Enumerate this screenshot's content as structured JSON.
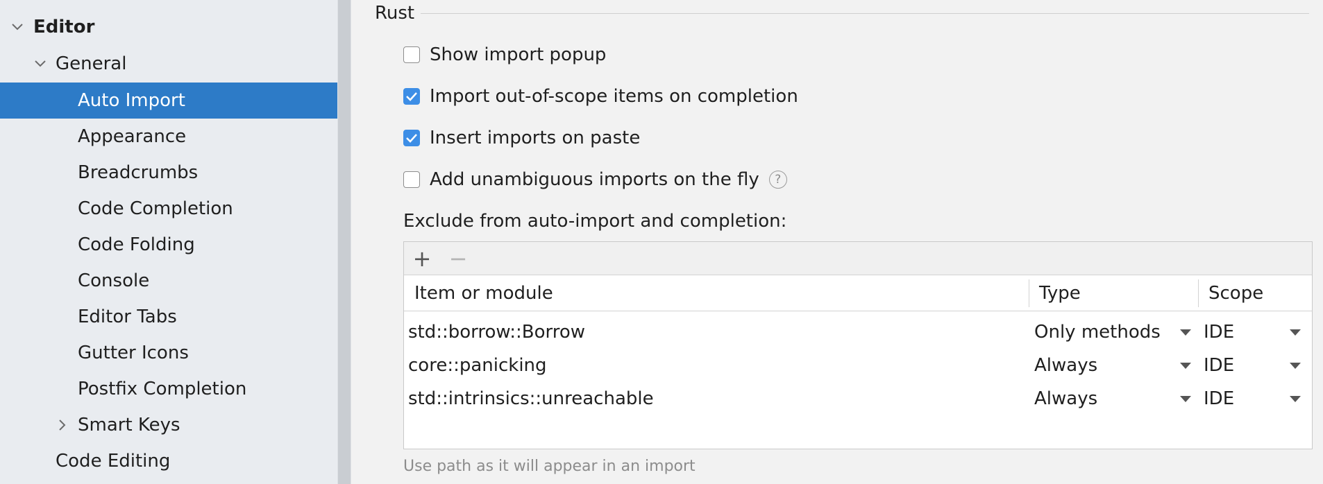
{
  "sidebar": {
    "editor_label": "Editor",
    "general_label": "General",
    "items": [
      {
        "label": "Auto Import"
      },
      {
        "label": "Appearance"
      },
      {
        "label": "Breadcrumbs"
      },
      {
        "label": "Code Completion"
      },
      {
        "label": "Code Folding"
      },
      {
        "label": "Console"
      },
      {
        "label": "Editor Tabs"
      },
      {
        "label": "Gutter Icons"
      },
      {
        "label": "Postfix Completion"
      },
      {
        "label": "Smart Keys"
      }
    ],
    "code_editing_label": "Code Editing",
    "selected": "Auto Import"
  },
  "section": {
    "title": "Rust"
  },
  "options": [
    {
      "label": "Show import popup",
      "checked": false
    },
    {
      "label": "Import out-of-scope items on completion",
      "checked": true
    },
    {
      "label": "Insert imports on paste",
      "checked": true
    },
    {
      "label": "Add unambiguous imports on the fly",
      "checked": false,
      "help": "?"
    }
  ],
  "exclude": {
    "label": "Exclude from auto-import and completion:",
    "toolbar": {
      "add_icon": "+",
      "remove_icon": "−"
    },
    "columns": [
      "Item or module",
      "Type",
      "Scope"
    ],
    "rows": [
      {
        "item": "std::borrow::Borrow",
        "type": "Only methods",
        "scope": "IDE"
      },
      {
        "item": "core::panicking",
        "type": "Always",
        "scope": "IDE"
      },
      {
        "item": "std::intrinsics::unreachable",
        "type": "Always",
        "scope": "IDE"
      }
    ],
    "hint": "Use path as it will appear in an import"
  },
  "colors": {
    "selection": "#2d7bc7",
    "checkbox_checked": "#3d8ee6"
  }
}
